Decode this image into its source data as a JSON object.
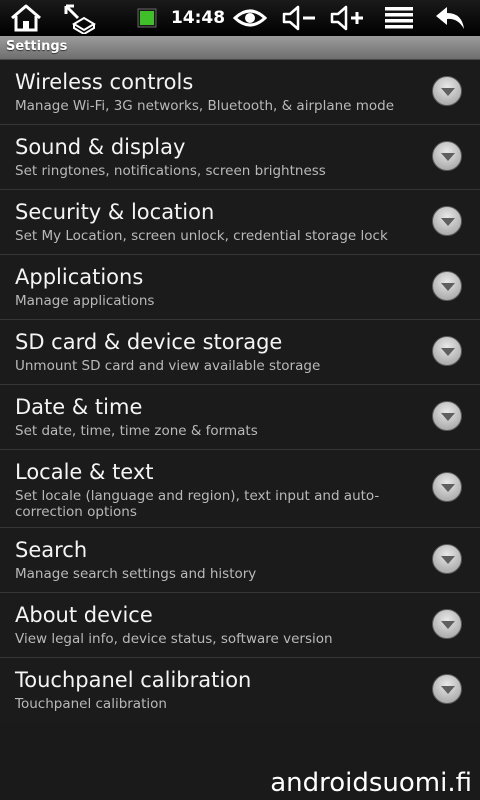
{
  "status_bar": {
    "time": "14:48",
    "icons": [
      "home-icon",
      "usb-icon",
      "battery-icon",
      "eye-icon",
      "volume-down-icon",
      "volume-up-icon",
      "menu-icon",
      "back-icon"
    ]
  },
  "title_bar": {
    "title": "Settings"
  },
  "settings": [
    {
      "title": "Wireless controls",
      "subtitle": "Manage Wi-Fi, 3G networks, Bluetooth, & airplane mode"
    },
    {
      "title": "Sound & display",
      "subtitle": "Set ringtones, notifications, screen brightness"
    },
    {
      "title": "Security & location",
      "subtitle": "Set My Location, screen unlock, credential storage lock"
    },
    {
      "title": "Applications",
      "subtitle": "Manage applications"
    },
    {
      "title": "SD card & device storage",
      "subtitle": "Unmount SD card and view available storage"
    },
    {
      "title": "Date & time",
      "subtitle": "Set date, time, time zone & formats"
    },
    {
      "title": "Locale & text",
      "subtitle": "Set locale (language and region), text input and auto-correction options"
    },
    {
      "title": "Search",
      "subtitle": "Manage search settings and history"
    },
    {
      "title": "About device",
      "subtitle": "View legal info, device status, software version"
    },
    {
      "title": "Touchpanel calibration",
      "subtitle": "Touchpanel calibration"
    }
  ],
  "watermark": "androidsuomi.fi"
}
